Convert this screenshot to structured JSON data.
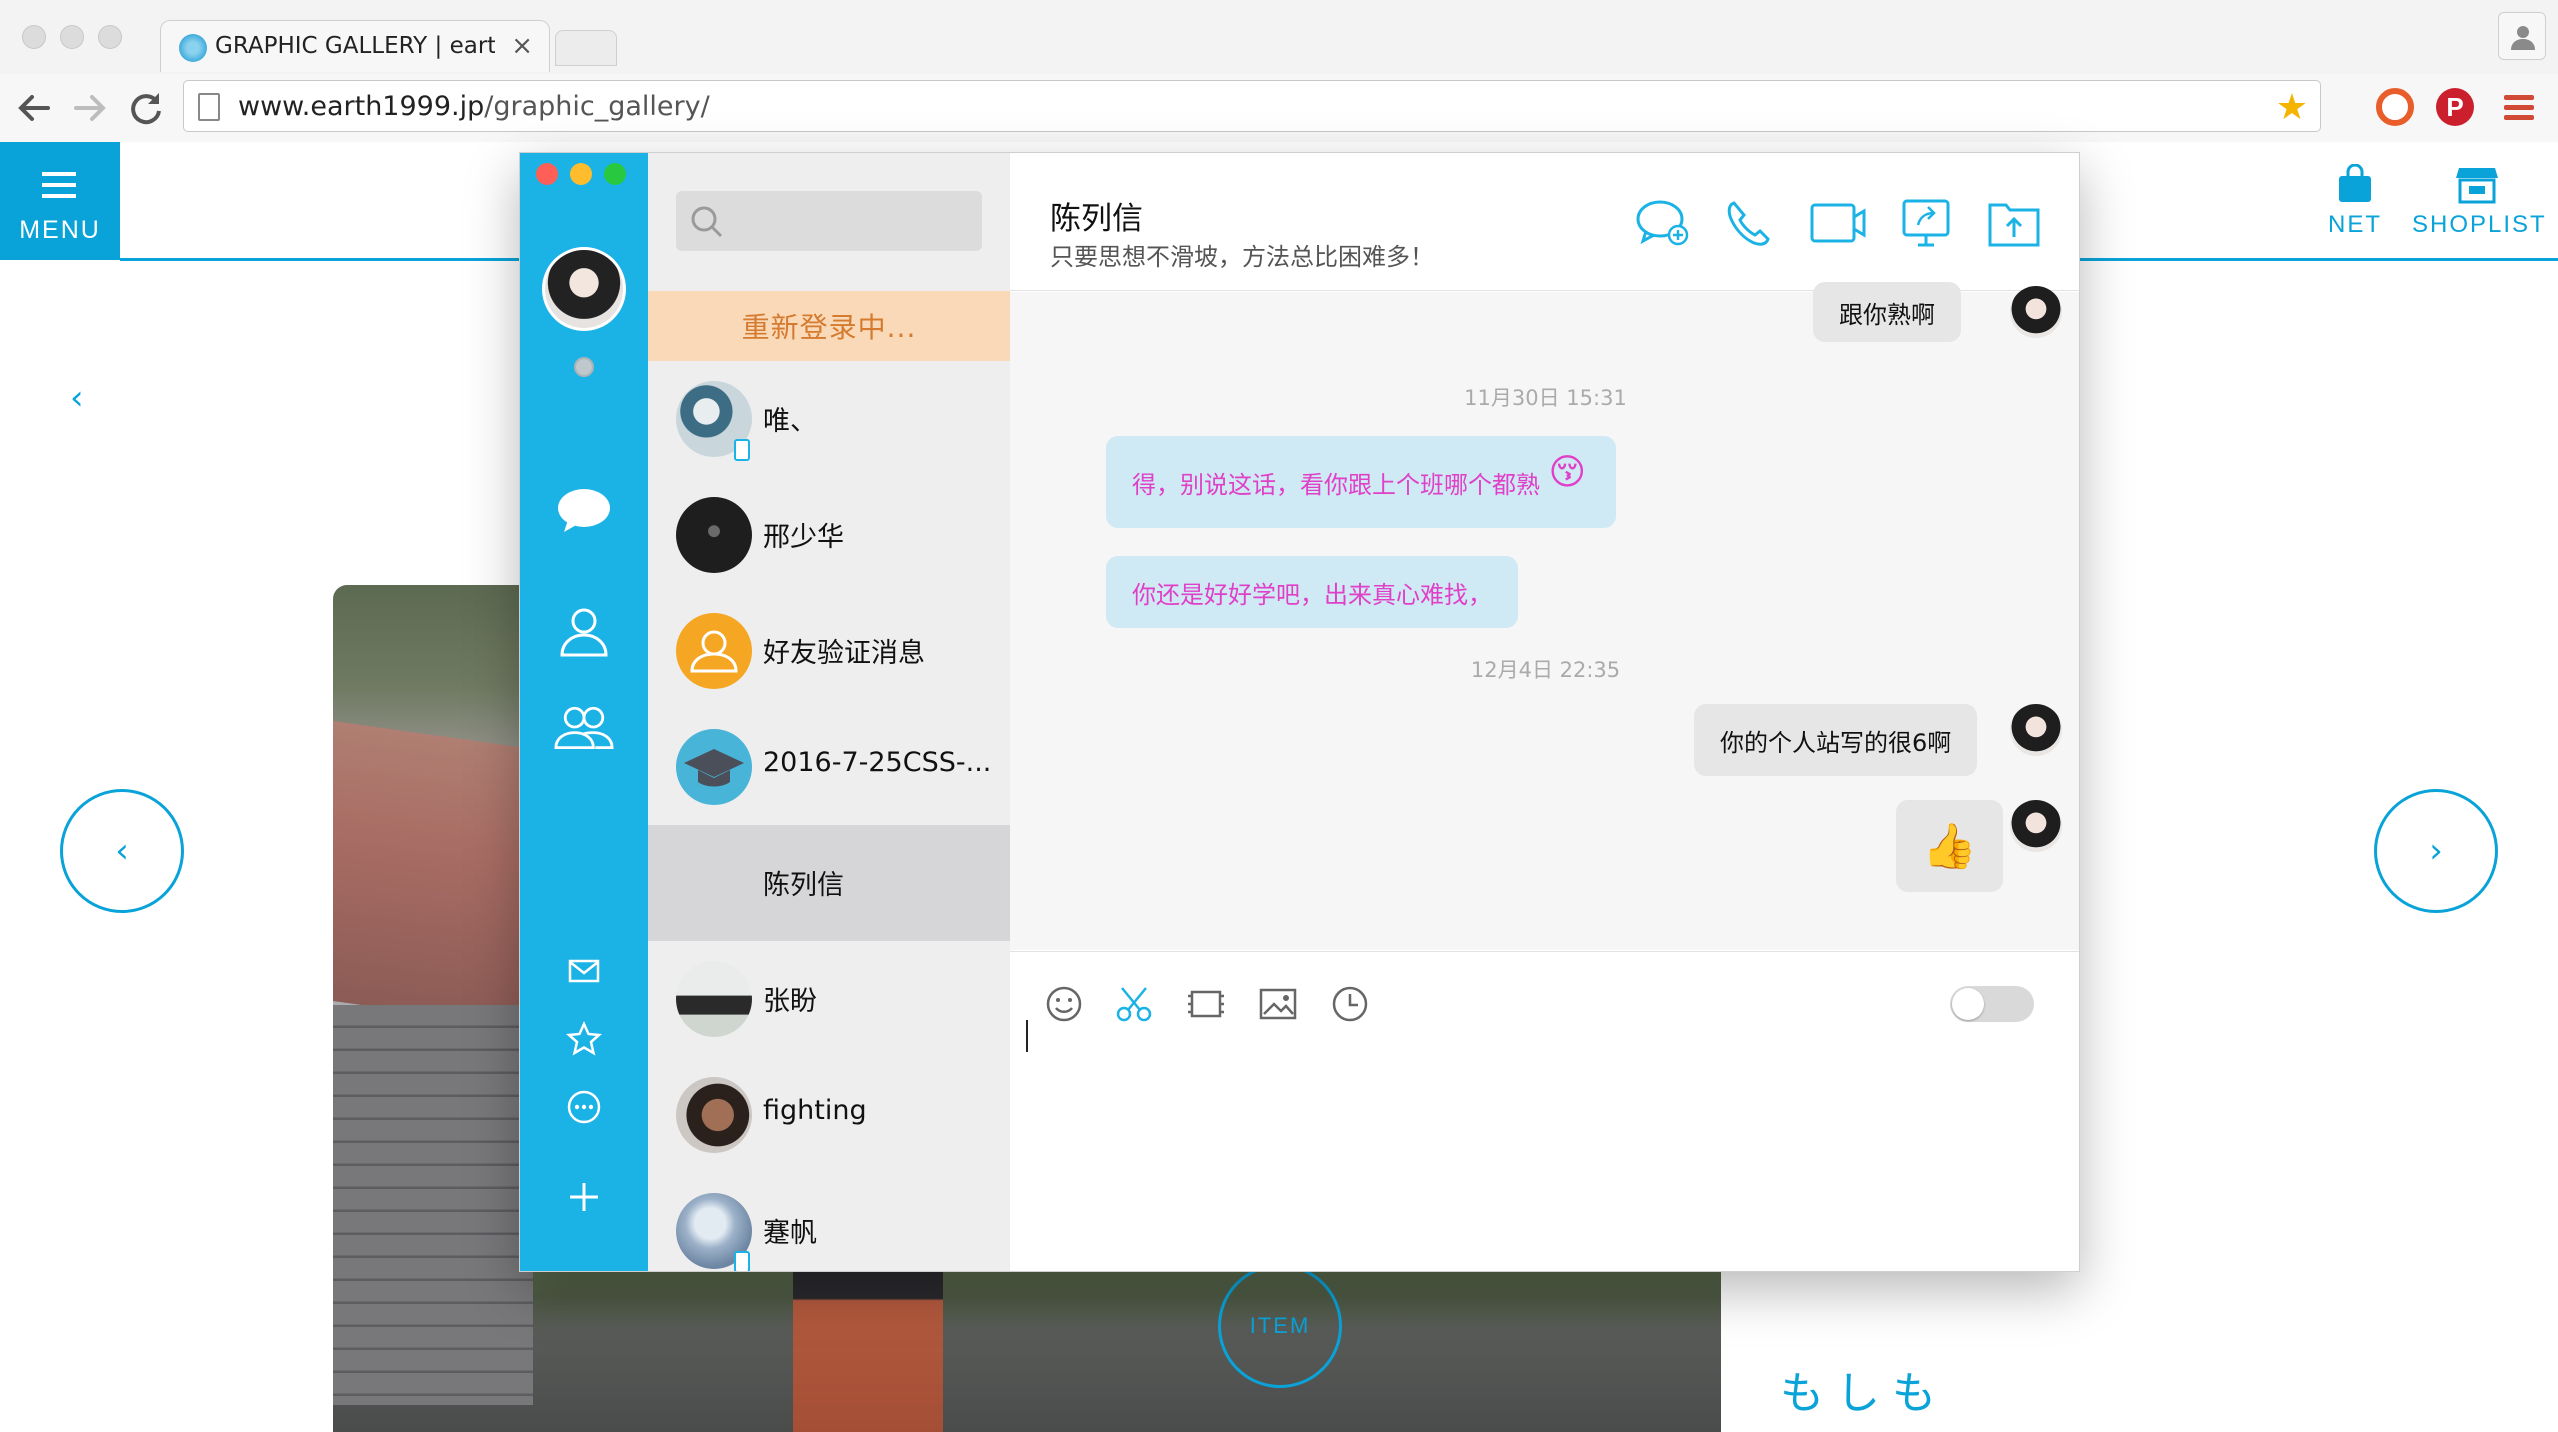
{
  "browser": {
    "tab_title": "GRAPHIC GALLERY | earth",
    "tab_close": "×",
    "url_host": "www.earth1999.jp",
    "url_path": "/graphic_gallery/"
  },
  "site": {
    "menu_label": "MENU",
    "net_label": "NET",
    "shoplist_label": "SHOPLIST",
    "back_arrow": "‹",
    "prev_arrow": "‹",
    "next_arrow": "›",
    "item_label": "ITEM",
    "jp_text": "もしも",
    "accent_color": "#0aa3d9"
  },
  "chat": {
    "relogin_text": "重新登录中...",
    "contacts": [
      {
        "name": "唯、",
        "mobile": true,
        "selected": false
      },
      {
        "name": "邢少华",
        "mobile": false,
        "selected": false
      },
      {
        "name": "好友验证消息",
        "mobile": false,
        "selected": false
      },
      {
        "name": "2016-7-25CSS-...",
        "mobile": false,
        "selected": false
      },
      {
        "name": "陈列信",
        "mobile": false,
        "selected": true
      },
      {
        "name": "张盼",
        "mobile": false,
        "selected": false
      },
      {
        "name": "fighting",
        "mobile": false,
        "selected": false
      },
      {
        "name": "蹇帆",
        "mobile": true,
        "selected": false
      }
    ],
    "peer_name": "陈列信",
    "peer_signature": "只要思想不滑坡，方法总比困难多！",
    "messages": [
      {
        "side": "right",
        "text": "跟你熟啊"
      },
      {
        "timestamp": "11月30日  15:31"
      },
      {
        "side": "left",
        "text": "得，别说这话，看你跟上个班哪个都熟"
      },
      {
        "side": "left",
        "text": "你还是好好学吧，出来真心难找，"
      },
      {
        "timestamp": "12月4日  22:35"
      },
      {
        "side": "right",
        "text": "你的个人站写的很6啊"
      },
      {
        "side": "right",
        "text": "👍"
      }
    ],
    "emoji_face": "😚",
    "bubble_left_text_color": "#e040c8",
    "bubble_left_bg": "#cfe9f5",
    "rail_color": "#1bb2e6"
  }
}
